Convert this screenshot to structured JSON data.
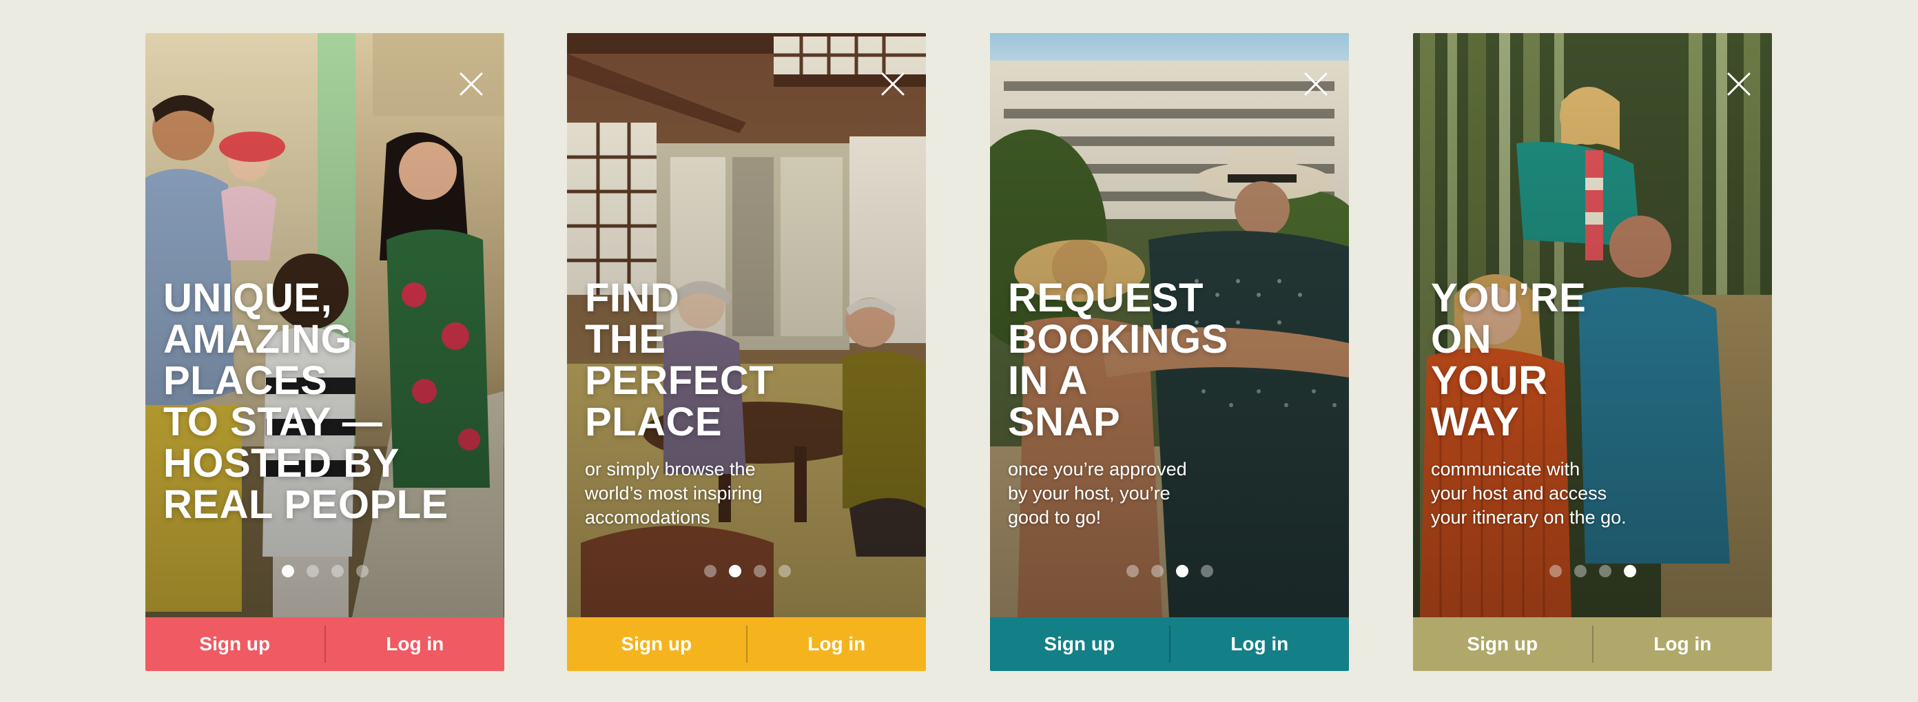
{
  "screens": [
    {
      "headline": "UNIQUE,\nAMAZING\nPLACES\nTO STAY —\nHOSTED BY\nREAL PEOPLE",
      "subtitle": "",
      "dots": {
        "count": 4,
        "active": 1
      },
      "sign_up_label": "Sign up",
      "log_in_label": "Log in",
      "bar_color": "#f05a62"
    },
    {
      "headline": "FIND\nTHE\nPERFECT\nPLACE",
      "subtitle": "or simply browse the\nworld’s most inspiring\naccomodations",
      "dots": {
        "count": 4,
        "active": 2
      },
      "sign_up_label": "Sign up",
      "log_in_label": "Log in",
      "bar_color": "#f5b41e"
    },
    {
      "headline": "REQUEST\nBOOKINGS\nIN A\nSNAP",
      "subtitle": "once you’re approved\nby your host, you’re\ngood to go!",
      "dots": {
        "count": 4,
        "active": 3
      },
      "sign_up_label": "Sign up",
      "log_in_label": "Log in",
      "bar_color": "#137f87"
    },
    {
      "headline": "YOU’RE\nON\nYOUR\nWAY",
      "subtitle": "communicate with\nyour host and access\nyour itinerary on the go.",
      "dots": {
        "count": 4,
        "active": 4
      },
      "sign_up_label": "Sign up",
      "log_in_label": "Log in",
      "bar_color": "#b0a86a"
    }
  ],
  "icons": {
    "close": "close-icon"
  },
  "colors": {
    "background": "#ecebe1",
    "text": "#ffffff"
  }
}
